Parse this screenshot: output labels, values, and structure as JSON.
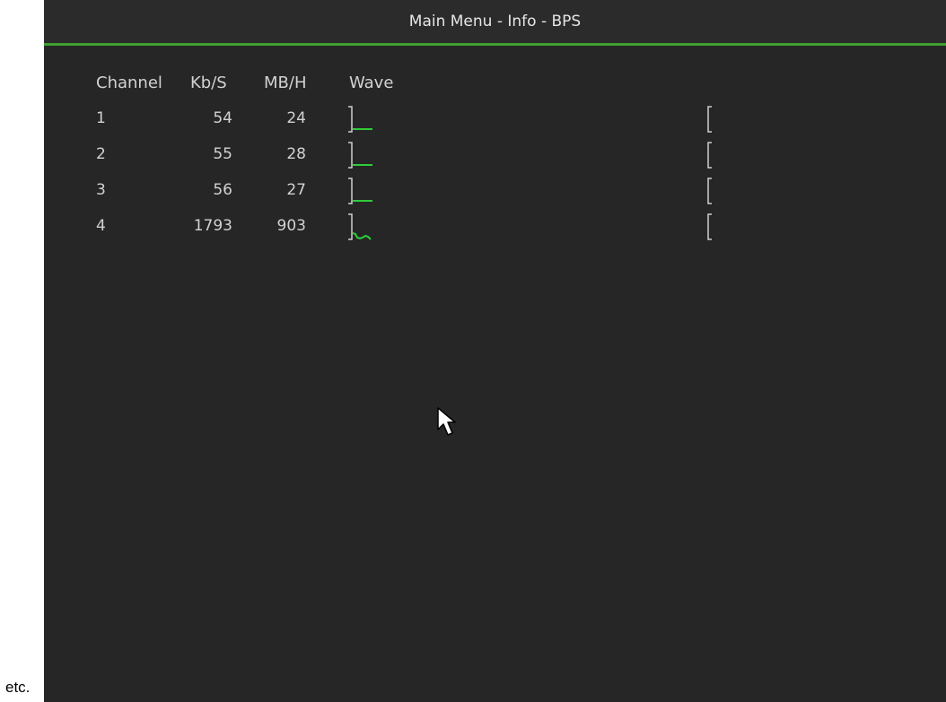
{
  "caption": "etc.",
  "window": {
    "title": "Main Menu - Info - BPS"
  },
  "table": {
    "headers": {
      "channel": "Channel",
      "kbs": "Kb/S",
      "mbh": "MB/H",
      "wave": "Wave"
    },
    "rows": [
      {
        "channel": "1",
        "kbs": "54",
        "mbh": "24",
        "wave_shape": "flat"
      },
      {
        "channel": "2",
        "kbs": "55",
        "mbh": "28",
        "wave_shape": "flat"
      },
      {
        "channel": "3",
        "kbs": "56",
        "mbh": "27",
        "wave_shape": "flat"
      },
      {
        "channel": "4",
        "kbs": "1793",
        "mbh": "903",
        "wave_shape": "wavy"
      }
    ]
  },
  "colors": {
    "background": "#262626",
    "accent_green": "#3f9f32",
    "wave_green": "#2ecc3a",
    "text": "#d2d2d2"
  },
  "icons": {
    "pointer": "mouse-pointer-icon"
  }
}
